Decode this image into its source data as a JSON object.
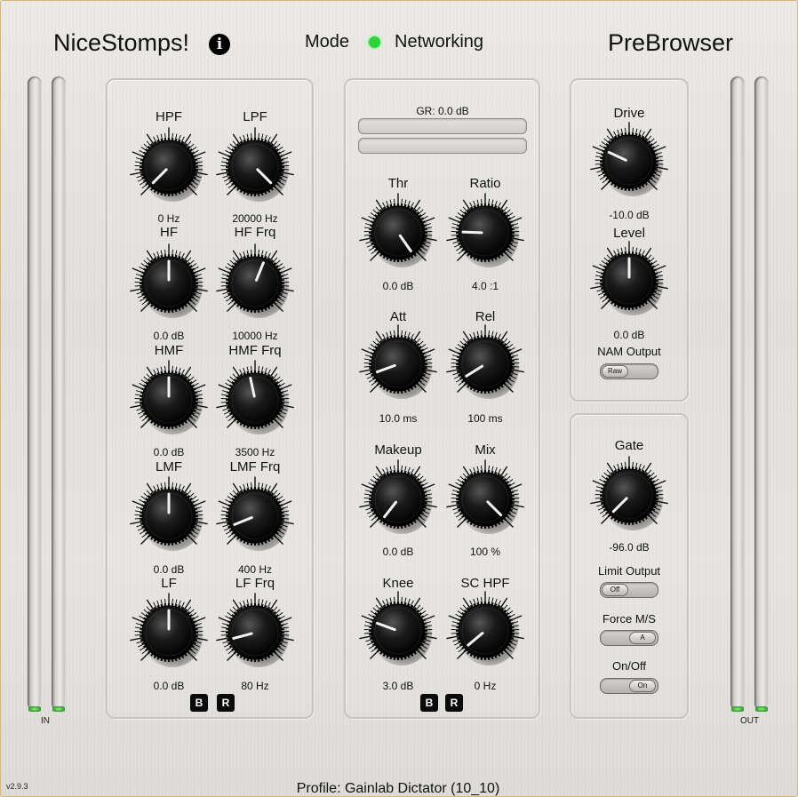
{
  "header": {
    "brand": "NiceStomps!",
    "info_icon": "i",
    "mode_label": "Mode",
    "mode_status_color": "#2ed23a",
    "networking_label": "Networking",
    "preset_browser": "PreBrowser"
  },
  "meters": {
    "in_label": "IN",
    "out_label": "OUT"
  },
  "eq": {
    "knobs": [
      {
        "label": "HPF",
        "value": "0 Hz",
        "pointer_deg": 225
      },
      {
        "label": "LPF",
        "value": "20000 Hz",
        "pointer_deg": 135
      },
      {
        "label": "HF",
        "value": "0.0 dB",
        "pointer_deg": 0
      },
      {
        "label": "HF Frq",
        "value": "10000 Hz",
        "pointer_deg": 22
      },
      {
        "label": "HMF",
        "value": "0.0 dB",
        "pointer_deg": 0
      },
      {
        "label": "HMF Frq",
        "value": "3500 Hz",
        "pointer_deg": -12
      },
      {
        "label": "LMF",
        "value": "0.0 dB",
        "pointer_deg": 0
      },
      {
        "label": "LMF Frq",
        "value": "400 Hz",
        "pointer_deg": -112
      },
      {
        "label": "LF",
        "value": "0.0 dB",
        "pointer_deg": 0
      },
      {
        "label": "LF Frq",
        "value": "80 Hz",
        "pointer_deg": -105
      }
    ],
    "buttons": [
      "B",
      "R"
    ]
  },
  "comp": {
    "gr_label": "GR: 0.0 dB",
    "knobs": [
      {
        "label": "Thr",
        "value": "0.0 dB",
        "pointer_deg": 145
      },
      {
        "label": "Ratio",
        "value": "4.0 :1",
        "pointer_deg": -88
      },
      {
        "label": "Att",
        "value": "10.0 ms",
        "pointer_deg": -110
      },
      {
        "label": "Rel",
        "value": "100 ms",
        "pointer_deg": -122
      },
      {
        "label": "Makeup",
        "value": "0.0 dB",
        "pointer_deg": -142
      },
      {
        "label": "Mix",
        "value": "100 %",
        "pointer_deg": 135
      },
      {
        "label": "Knee",
        "value": "3.0 dB",
        "pointer_deg": -70
      },
      {
        "label": "SC HPF",
        "value": "0 Hz",
        "pointer_deg": -130
      }
    ],
    "buttons": [
      "B",
      "R"
    ]
  },
  "amp": {
    "knobs": [
      {
        "label": "Drive",
        "value": "-10.0 dB",
        "pointer_deg": -65
      },
      {
        "label": "Level",
        "value": "0.0 dB",
        "pointer_deg": 0
      }
    ],
    "nam_output_label": "NAM Output",
    "nam_output_value": "Raw"
  },
  "gate": {
    "knob": {
      "label": "Gate",
      "value": "-96.0 dB",
      "pointer_deg": -135
    },
    "limit_output_label": "Limit Output",
    "limit_output_value": "Off",
    "force_ms_label": "Force M/S",
    "force_ms_value": "A",
    "onoff_label": "On/Off",
    "onoff_value": "On"
  },
  "footer": {
    "version": "v2.9.3",
    "profile": "Profile: Gainlab Dictator (10_10)"
  }
}
